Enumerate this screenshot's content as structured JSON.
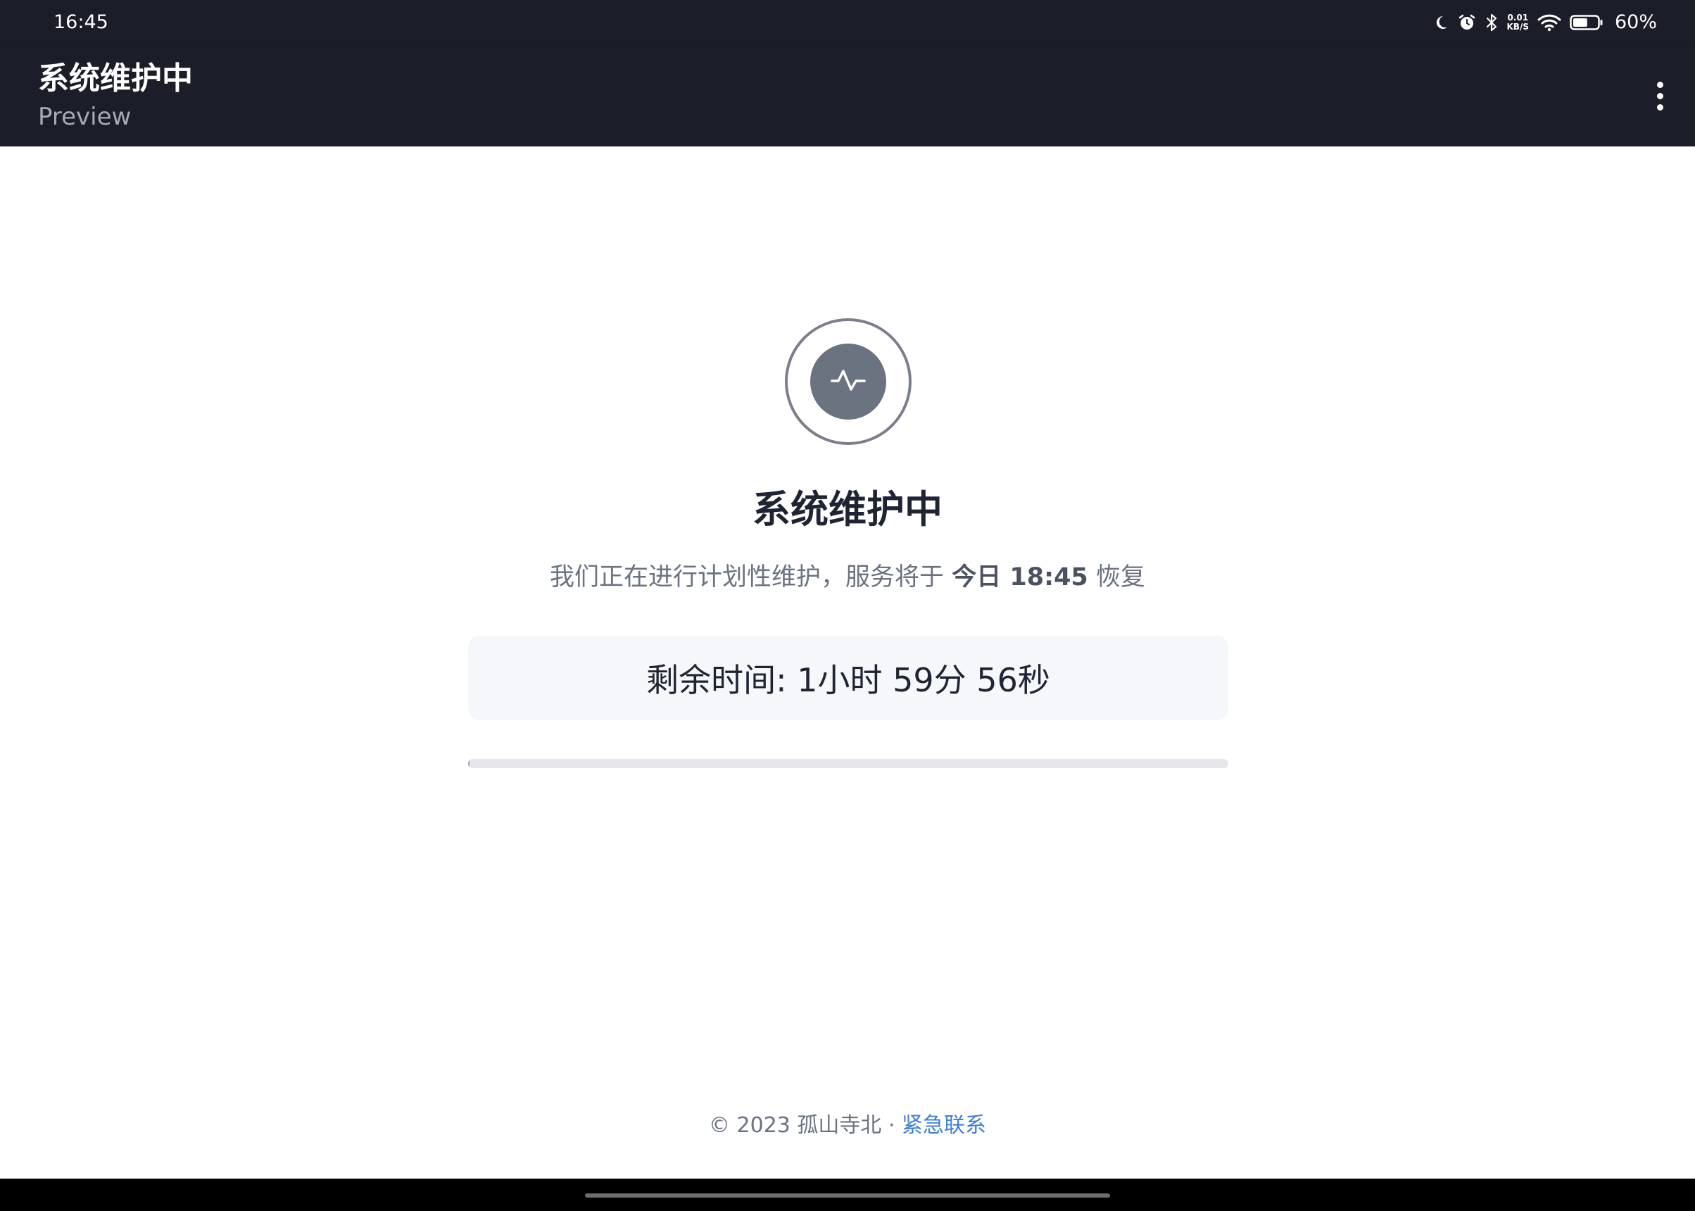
{
  "status_bar": {
    "time": "16:45",
    "net_speed_value": "0.01",
    "net_speed_unit": "KB/S",
    "battery_percent_text": "60%",
    "battery_level": 0.6
  },
  "app_bar": {
    "title": "系统维护中",
    "subtitle": "Preview"
  },
  "main": {
    "title": "系统维护中",
    "message_prefix": "我们正在进行计划性维护，服务将于 ",
    "message_emphasis": "今日 18:45",
    "message_suffix": " 恢复",
    "countdown_text": "剩余时间: 1小时 59分 56秒",
    "progress_fraction": 0.002
  },
  "footer": {
    "copyright": "© 2023 孤山寺北 · ",
    "contact_link": "紧急联系"
  },
  "colors": {
    "bar_background": "#1b1d29",
    "emblem_fill": "#6b7280",
    "link": "#3f7fd1"
  },
  "icons": [
    "moon-icon",
    "alarm-icon",
    "bluetooth-icon",
    "wifi-icon",
    "battery-icon",
    "overflow-menu-icon",
    "activity-pulse-icon"
  ]
}
